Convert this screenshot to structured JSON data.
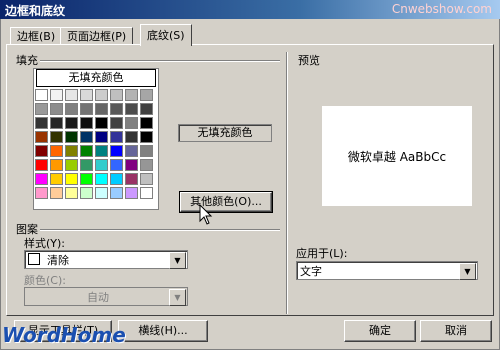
{
  "window": {
    "title": "边框和底纹",
    "watermark": "Cnwebshow.com"
  },
  "tabs": [
    {
      "label": "边框(B)"
    },
    {
      "label": "页面边框(P)"
    },
    {
      "label": "底纹(S)"
    }
  ],
  "fill": {
    "group_label": "填充",
    "no_fill_label": "无填充颜色",
    "selected_color_label": "无填充颜色",
    "more_colors_button": "其他颜色(O)...",
    "palette_colors": [
      "#ffffff",
      "#f2f2f2",
      "#e6e6e6",
      "#d9d9d9",
      "#cccccc",
      "#bfbfbf",
      "#b3b3b3",
      "#a6a6a6",
      "#999999",
      "#8c8c8c",
      "#808080",
      "#737373",
      "#666666",
      "#595959",
      "#4d4d4d",
      "#404040",
      "#333333",
      "#262626",
      "#1a1a1a",
      "#0d0d0d",
      "#000000",
      "#404040",
      "#808080",
      "#000000",
      "#993300",
      "#333300",
      "#003300",
      "#003366",
      "#000080",
      "#333399",
      "#333333",
      "#000000",
      "#800000",
      "#ff6600",
      "#808000",
      "#008000",
      "#008080",
      "#0000ff",
      "#666699",
      "#808080",
      "#ff0000",
      "#ff9900",
      "#99cc00",
      "#339966",
      "#33cccc",
      "#3366ff",
      "#800080",
      "#969696",
      "#ff00ff",
      "#ffcc00",
      "#ffff00",
      "#00ff00",
      "#00ffff",
      "#00ccff",
      "#993366",
      "#c0c0c0",
      "#ff99cc",
      "#ffcc99",
      "#ffff99",
      "#ccffcc",
      "#ccffff",
      "#99ccff",
      "#cc99ff",
      "#ffffff"
    ]
  },
  "pattern": {
    "group_label": "图案",
    "style_label": "样式(Y):",
    "style_value": "清除",
    "color_label": "颜色(C):",
    "color_value": "自动"
  },
  "preview": {
    "group_label": "预览",
    "sample_text": "微软卓越 AaBbCc",
    "apply_to_label": "应用于(L):",
    "apply_to_value": "文字"
  },
  "buttons": {
    "show_toolbar": "显示工具栏(T)",
    "horizontal_line": "横线(H)...",
    "ok": "确定",
    "cancel": "取消"
  },
  "branding": {
    "wordhome": "WordHome"
  }
}
